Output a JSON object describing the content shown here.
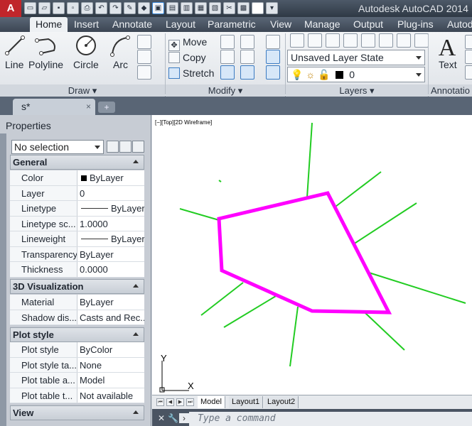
{
  "app": {
    "title": "Autodesk AutoCAD 2014",
    "logo_letter": "A"
  },
  "ribbon": {
    "tabs": [
      "Home",
      "Insert",
      "Annotate",
      "Layout",
      "Parametric",
      "View",
      "Manage",
      "Output",
      "Plug-ins",
      "Autod"
    ],
    "active_tab": "Home",
    "draw": {
      "title": "Draw",
      "line_label": "Line",
      "polyline_label": "Polyline",
      "circle_label": "Circle",
      "arc_label": "Arc"
    },
    "modify": {
      "title": "Modify",
      "move_label": "Move",
      "copy_label": "Copy",
      "stretch_label": "Stretch"
    },
    "layers": {
      "title": "Layers",
      "layer_state": "Unsaved Layer State",
      "current_layer": "0"
    },
    "annotation": {
      "title": "Annotatio",
      "text_label": "Text"
    }
  },
  "document": {
    "tab_name": "s*",
    "close_glyph": "×",
    "new_tab_glyph": "+"
  },
  "properties": {
    "title": "Properties",
    "selection": "No selection",
    "sections": {
      "general": "General",
      "viz3d": "3D Visualization",
      "plot": "Plot style",
      "view": "View"
    },
    "general_rows": [
      {
        "key": "Color",
        "value": "ByLayer"
      },
      {
        "key": "Layer",
        "value": "0"
      },
      {
        "key": "Linetype",
        "value": "ByLayer"
      },
      {
        "key": "Linetype sc...",
        "value": "1.0000"
      },
      {
        "key": "Lineweight",
        "value": "ByLayer"
      },
      {
        "key": "Transparency",
        "value": "ByLayer"
      },
      {
        "key": "Thickness",
        "value": "0.0000"
      }
    ],
    "viz3d_rows": [
      {
        "key": "Material",
        "value": "ByLayer"
      },
      {
        "key": "Shadow dis...",
        "value": "Casts and Rec..."
      }
    ],
    "plot_rows": [
      {
        "key": "Plot style",
        "value": "ByColor"
      },
      {
        "key": "Plot style ta...",
        "value": "None"
      },
      {
        "key": "Plot table a...",
        "value": "Model"
      },
      {
        "key": "Plot table t...",
        "value": "Not available"
      }
    ]
  },
  "viewport": {
    "label": "[−][Top][2D Wireframe]",
    "ucs_x": "X",
    "ucs_y": "Y"
  },
  "layout_tabs": [
    "Model",
    "Layout1",
    "Layout2"
  ],
  "command_line": {
    "placeholder": "Type a command"
  },
  "colors": {
    "polygon": "#ff00ff",
    "lines": "#22cc22"
  }
}
